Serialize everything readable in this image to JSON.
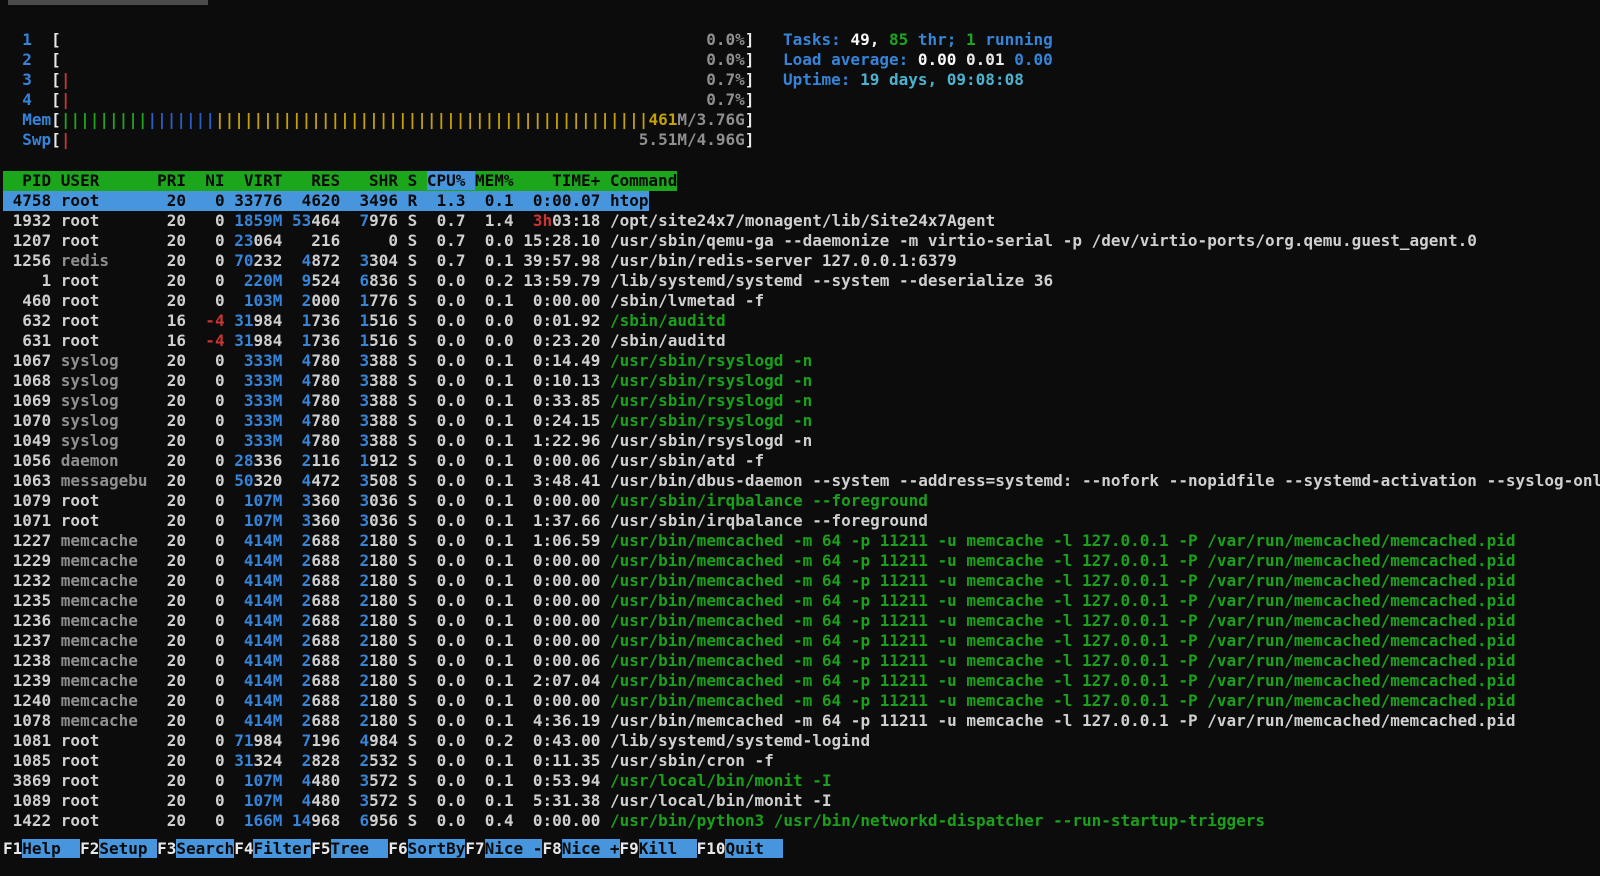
{
  "palette": {
    "background": "#0c0c0c",
    "default_text": "#cfcfcf",
    "blue": "#3584d8",
    "green": "#1aa11a",
    "yellow": "#c4a104",
    "red": "#c93535",
    "dim": "#8f8f8f",
    "cyan": "#4db2cf",
    "header_bg": "#1ca61c",
    "selection_bg": "#4795dc"
  },
  "meters": [
    {
      "label": "1",
      "kind": "cpu",
      "bars": [],
      "value": [
        [
          "0.0%",
          "d"
        ]
      ]
    },
    {
      "label": "2",
      "kind": "cpu",
      "bars": [],
      "value": [
        [
          "0.0%",
          "d"
        ]
      ]
    },
    {
      "label": "3",
      "kind": "cpu",
      "bars": [
        [
          1,
          "r"
        ]
      ],
      "value": [
        [
          "0.7%",
          "d"
        ]
      ]
    },
    {
      "label": "4",
      "kind": "cpu",
      "bars": [
        [
          1,
          "r"
        ]
      ],
      "value": [
        [
          "0.7%",
          "d"
        ]
      ]
    },
    {
      "label": "Mem",
      "kind": "mem",
      "bars": [
        [
          9,
          "gb"
        ],
        [
          7,
          "bb"
        ],
        [
          45,
          "gold"
        ]
      ],
      "value": [
        [
          "461",
          "gold"
        ],
        [
          "M/3.76G",
          "d"
        ]
      ]
    },
    {
      "label": "Swp",
      "kind": "swp",
      "bars": [
        [
          1,
          "r"
        ]
      ],
      "value": [
        [
          "5.51M/4.96G",
          "d"
        ]
      ]
    }
  ],
  "summary": {
    "tasks": [
      [
        "Tasks: ",
        "b"
      ],
      [
        "49, ",
        "wb"
      ],
      [
        "85",
        "gb"
      ],
      [
        " thr",
        "b"
      ],
      [
        "; ",
        "b"
      ],
      [
        "1",
        "gb"
      ],
      [
        " running",
        "b"
      ]
    ],
    "load": [
      [
        "Load average: ",
        "b"
      ],
      [
        "0.00 ",
        "wb"
      ],
      [
        "0.01 ",
        "w"
      ],
      [
        "0.00",
        "b"
      ]
    ],
    "uptime": [
      [
        "Uptime: ",
        "b"
      ],
      [
        "19 days, ",
        "cy"
      ],
      [
        "09:08:08",
        "cy"
      ]
    ]
  },
  "table": {
    "header_cells": [
      "  PID",
      "USER     ",
      "PRI",
      " NI",
      " VIRT",
      "  RES",
      "  SHR",
      "S",
      "CPU%",
      "MEM%",
      "   TIME+",
      "Command"
    ],
    "sort_column": "CPU%",
    "rows": [
      [
        "4758",
        "root",
        "20",
        "0",
        "33776",
        "4620",
        "3496",
        "R",
        "1.3",
        "0.1",
        "0:00.07",
        "htop",
        "S"
      ],
      [
        "1932",
        "root",
        "20",
        "0",
        "1859M",
        "53464",
        "7976",
        "S",
        "0.7",
        "1.4",
        "3h03:18",
        "/opt/site24x7/monagent/lib/Site24x7Agent",
        "H"
      ],
      [
        "1207",
        "root",
        "20",
        "0",
        "23064",
        "216",
        "0",
        "S",
        "0.7",
        "0.0",
        "15:28.10",
        "/usr/sbin/qemu-ga --daemonize -m virtio-serial -p /dev/virtio-ports/org.qemu.guest_agent.0",
        ""
      ],
      [
        "1256",
        "redis",
        "20",
        "0",
        "70232",
        "4872",
        "3304",
        "S",
        "0.7",
        "0.1",
        "39:57.98",
        "/usr/bin/redis-server 127.0.0.1:6379",
        "D"
      ],
      [
        "1",
        "root",
        "20",
        "0",
        "220M",
        "9524",
        "6836",
        "S",
        "0.0",
        "0.2",
        "13:59.79",
        "/lib/systemd/systemd --system --deserialize 36",
        ""
      ],
      [
        "460",
        "root",
        "20",
        "0",
        "103M",
        "2000",
        "1776",
        "S",
        "0.0",
        "0.1",
        "0:00.00",
        "/sbin/lvmetad -f",
        ""
      ],
      [
        "632",
        "root",
        "16",
        "-4",
        "31984",
        "1736",
        "1516",
        "S",
        "0.0",
        "0.0",
        "0:01.92",
        "/sbin/auditd",
        "NG"
      ],
      [
        "631",
        "root",
        "16",
        "-4",
        "31984",
        "1736",
        "1516",
        "S",
        "0.0",
        "0.0",
        "0:23.20",
        "/sbin/auditd",
        "N"
      ],
      [
        "1067",
        "syslog",
        "20",
        "0",
        "333M",
        "4780",
        "3388",
        "S",
        "0.0",
        "0.1",
        "0:14.49",
        "/usr/sbin/rsyslogd -n",
        "DG"
      ],
      [
        "1068",
        "syslog",
        "20",
        "0",
        "333M",
        "4780",
        "3388",
        "S",
        "0.0",
        "0.1",
        "0:10.13",
        "/usr/sbin/rsyslogd -n",
        "DG"
      ],
      [
        "1069",
        "syslog",
        "20",
        "0",
        "333M",
        "4780",
        "3388",
        "S",
        "0.0",
        "0.1",
        "0:33.85",
        "/usr/sbin/rsyslogd -n",
        "DG"
      ],
      [
        "1070",
        "syslog",
        "20",
        "0",
        "333M",
        "4780",
        "3388",
        "S",
        "0.0",
        "0.1",
        "0:24.15",
        "/usr/sbin/rsyslogd -n",
        "DG"
      ],
      [
        "1049",
        "syslog",
        "20",
        "0",
        "333M",
        "4780",
        "3388",
        "S",
        "0.0",
        "0.1",
        "1:22.96",
        "/usr/sbin/rsyslogd -n",
        "D"
      ],
      [
        "1056",
        "daemon",
        "20",
        "0",
        "28336",
        "2116",
        "1912",
        "S",
        "0.0",
        "0.1",
        "0:00.06",
        "/usr/sbin/atd -f",
        "D"
      ],
      [
        "1063",
        "messagebu",
        "20",
        "0",
        "50320",
        "4472",
        "3508",
        "S",
        "0.0",
        "0.1",
        "3:48.41",
        "/usr/bin/dbus-daemon --system --address=systemd: --nofork --nopidfile --systemd-activation --syslog-only",
        "D"
      ],
      [
        "1079",
        "root",
        "20",
        "0",
        "107M",
        "3360",
        "3036",
        "S",
        "0.0",
        "0.1",
        "0:00.00",
        "/usr/sbin/irqbalance --foreground",
        "G"
      ],
      [
        "1071",
        "root",
        "20",
        "0",
        "107M",
        "3360",
        "3036",
        "S",
        "0.0",
        "0.1",
        "1:37.66",
        "/usr/sbin/irqbalance --foreground",
        ""
      ],
      [
        "1227",
        "memcache",
        "20",
        "0",
        "414M",
        "2688",
        "2180",
        "S",
        "0.0",
        "0.1",
        "1:06.59",
        "/usr/bin/memcached -m 64 -p 11211 -u memcache -l 127.0.0.1 -P /var/run/memcached/memcached.pid",
        "DG"
      ],
      [
        "1229",
        "memcache",
        "20",
        "0",
        "414M",
        "2688",
        "2180",
        "S",
        "0.0",
        "0.1",
        "0:00.00",
        "/usr/bin/memcached -m 64 -p 11211 -u memcache -l 127.0.0.1 -P /var/run/memcached/memcached.pid",
        "DG"
      ],
      [
        "1232",
        "memcache",
        "20",
        "0",
        "414M",
        "2688",
        "2180",
        "S",
        "0.0",
        "0.1",
        "0:00.00",
        "/usr/bin/memcached -m 64 -p 11211 -u memcache -l 127.0.0.1 -P /var/run/memcached/memcached.pid",
        "DG"
      ],
      [
        "1235",
        "memcache",
        "20",
        "0",
        "414M",
        "2688",
        "2180",
        "S",
        "0.0",
        "0.1",
        "0:00.00",
        "/usr/bin/memcached -m 64 -p 11211 -u memcache -l 127.0.0.1 -P /var/run/memcached/memcached.pid",
        "DG"
      ],
      [
        "1236",
        "memcache",
        "20",
        "0",
        "414M",
        "2688",
        "2180",
        "S",
        "0.0",
        "0.1",
        "0:00.00",
        "/usr/bin/memcached -m 64 -p 11211 -u memcache -l 127.0.0.1 -P /var/run/memcached/memcached.pid",
        "DG"
      ],
      [
        "1237",
        "memcache",
        "20",
        "0",
        "414M",
        "2688",
        "2180",
        "S",
        "0.0",
        "0.1",
        "0:00.00",
        "/usr/bin/memcached -m 64 -p 11211 -u memcache -l 127.0.0.1 -P /var/run/memcached/memcached.pid",
        "DG"
      ],
      [
        "1238",
        "memcache",
        "20",
        "0",
        "414M",
        "2688",
        "2180",
        "S",
        "0.0",
        "0.1",
        "0:00.06",
        "/usr/bin/memcached -m 64 -p 11211 -u memcache -l 127.0.0.1 -P /var/run/memcached/memcached.pid",
        "DG"
      ],
      [
        "1239",
        "memcache",
        "20",
        "0",
        "414M",
        "2688",
        "2180",
        "S",
        "0.0",
        "0.1",
        "2:07.04",
        "/usr/bin/memcached -m 64 -p 11211 -u memcache -l 127.0.0.1 -P /var/run/memcached/memcached.pid",
        "DG"
      ],
      [
        "1240",
        "memcache",
        "20",
        "0",
        "414M",
        "2688",
        "2180",
        "S",
        "0.0",
        "0.1",
        "0:00.00",
        "/usr/bin/memcached -m 64 -p 11211 -u memcache -l 127.0.0.1 -P /var/run/memcached/memcached.pid",
        "DG"
      ],
      [
        "1078",
        "memcache",
        "20",
        "0",
        "414M",
        "2688",
        "2180",
        "S",
        "0.0",
        "0.1",
        "4:36.19",
        "/usr/bin/memcached -m 64 -p 11211 -u memcache -l 127.0.0.1 -P /var/run/memcached/memcached.pid",
        "D"
      ],
      [
        "1081",
        "root",
        "20",
        "0",
        "71984",
        "7196",
        "4984",
        "S",
        "0.0",
        "0.2",
        "0:43.00",
        "/lib/systemd/systemd-logind",
        ""
      ],
      [
        "1085",
        "root",
        "20",
        "0",
        "31324",
        "2828",
        "2532",
        "S",
        "0.0",
        "0.1",
        "0:11.35",
        "/usr/sbin/cron -f",
        ""
      ],
      [
        "3869",
        "root",
        "20",
        "0",
        "107M",
        "4480",
        "3572",
        "S",
        "0.0",
        "0.1",
        "0:53.94",
        "/usr/local/bin/monit -I",
        "G"
      ],
      [
        "1089",
        "root",
        "20",
        "0",
        "107M",
        "4480",
        "3572",
        "S",
        "0.0",
        "0.1",
        "5:31.38",
        "/usr/local/bin/monit -I",
        ""
      ],
      [
        "1422",
        "root",
        "20",
        "0",
        "166M",
        "14968",
        "6956",
        "S",
        "0.0",
        "0.4",
        "0:00.00",
        "/usr/bin/python3 /usr/bin/networkd-dispatcher --run-startup-triggers",
        "G"
      ]
    ]
  },
  "fnbar": [
    [
      "F1",
      "Help  "
    ],
    [
      "F2",
      "Setup "
    ],
    [
      "F3",
      "Search"
    ],
    [
      "F4",
      "Filter"
    ],
    [
      "F5",
      "Tree  "
    ],
    [
      "F6",
      "SortBy"
    ],
    [
      "F7",
      "Nice -"
    ],
    [
      "F8",
      "Nice +"
    ],
    [
      "F9",
      "Kill  "
    ],
    [
      "F10",
      "Quit  "
    ]
  ]
}
